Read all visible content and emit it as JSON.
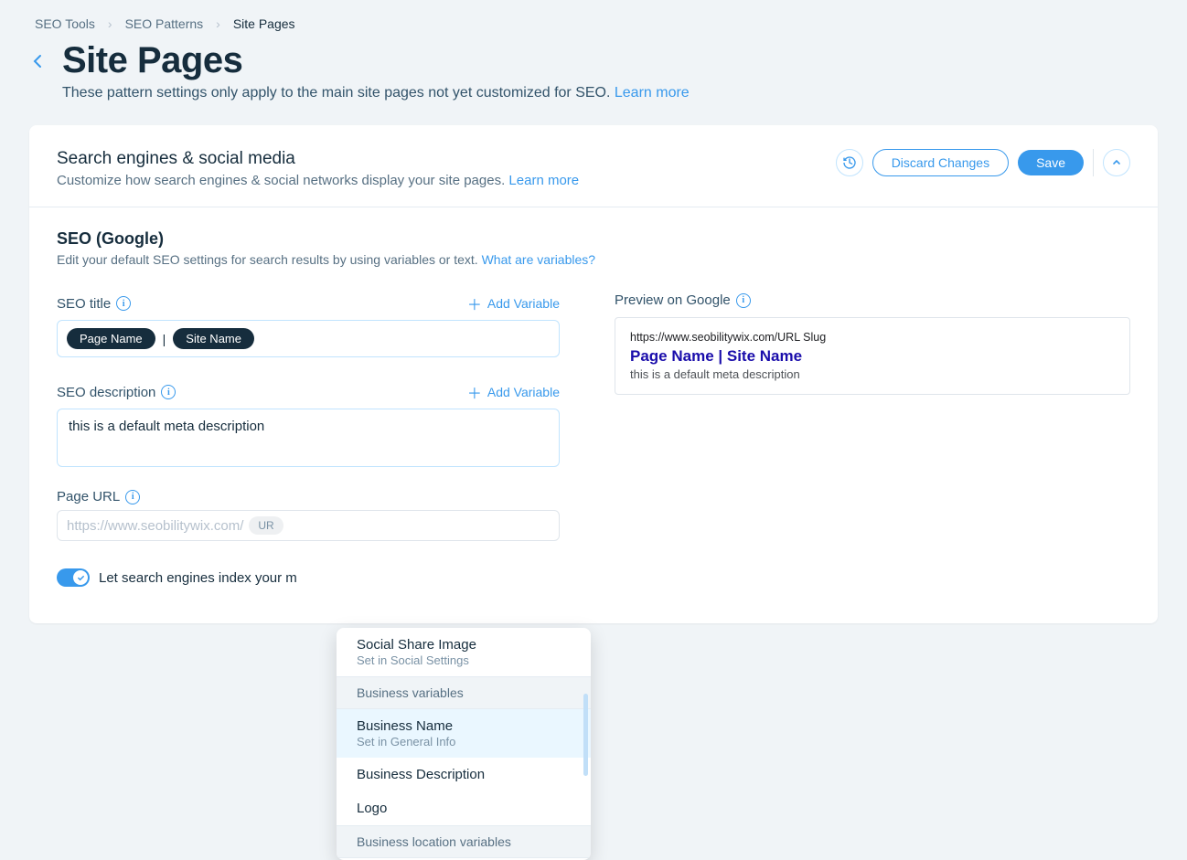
{
  "breadcrumb": {
    "l1": "SEO Tools",
    "l2": "SEO Patterns",
    "l3": "Site Pages"
  },
  "page": {
    "title": "Site Pages",
    "subtitle_text": "These pattern settings only apply to the main site pages not yet customized for SEO. ",
    "subtitle_link": "Learn more"
  },
  "cardHeader": {
    "title": "Search engines & social media",
    "desc_text": "Customize how search engines & social networks display your site pages. ",
    "desc_link": "Learn more",
    "discard": "Discard Changes",
    "save": "Save"
  },
  "seoSection": {
    "title": "SEO (Google)",
    "sub_text": "Edit your default SEO settings for search results by using variables or text. ",
    "sub_link": "What are variables?"
  },
  "fields": {
    "seoTitle": {
      "label": "SEO title",
      "addVar": "Add Variable",
      "chip1": "Page Name",
      "sep": "|",
      "chip2": "Site Name"
    },
    "seoDesc": {
      "label": "SEO description",
      "addVar": "Add Variable",
      "value": "this is a default meta description"
    },
    "pageUrl": {
      "label": "Page URL",
      "prefix": "https://www.seobilitywix.com/",
      "chip": "UR"
    },
    "toggle": {
      "label": "Let search engines index your m"
    }
  },
  "preview": {
    "label": "Preview on Google",
    "url": "https://www.seobilitywix.com/URL Slug",
    "title": "Page Name | Site Name",
    "desc": "this is a default meta description"
  },
  "dropdown": {
    "item1_title": "Social Share Image",
    "item1_sub": "Set in Social Settings",
    "group1": "Business variables",
    "item2_title": "Business Name",
    "item2_sub": "Set in General Info",
    "item3_title": "Business Description",
    "item4_title": "Logo",
    "group2": "Business location variables"
  }
}
